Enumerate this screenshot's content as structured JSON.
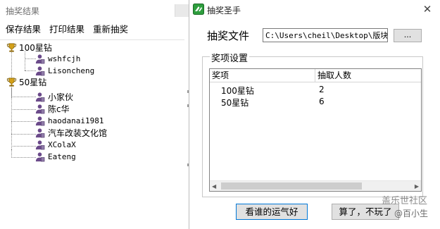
{
  "background_window": {
    "title": "抽奖结果",
    "menu": [
      "保存结果",
      "打印结果",
      "重新抽奖"
    ],
    "tree": {
      "groups": [
        {
          "label": "100星钻",
          "children": [
            "wshfcjh",
            "Lisoncheng"
          ]
        },
        {
          "label": "50星钻",
          "children": [
            "小家伙",
            "陈c华",
            "haodanai1981",
            "汽车改装文化馆",
            "XColaX",
            "Eateng"
          ]
        }
      ]
    }
  },
  "dialog": {
    "title": "抽奖圣手",
    "file_label": "抽奖文件",
    "file_path": "C:\\Users\\cheil\\Desktop\\版块活",
    "browse_label": "...",
    "group_title": "奖项设置",
    "columns": [
      "奖项",
      "抽取人数"
    ],
    "rows": [
      {
        "prize": "100星钻",
        "count": "2"
      },
      {
        "prize": "50星钻",
        "count": "6"
      }
    ],
    "lucky_button": "看谁的运气好",
    "quit_button": "算了，不玩了"
  },
  "watermark": {
    "line1": "盖乐世社区",
    "line2": "@百小生"
  },
  "icons": {
    "app": "app-icon",
    "close": "close-icon",
    "trophy": "trophy-icon",
    "person": "person-icon"
  },
  "colors": {
    "focus_border": "#0078d7",
    "trophy": "#d4a017",
    "person": "#6b4a8a"
  }
}
